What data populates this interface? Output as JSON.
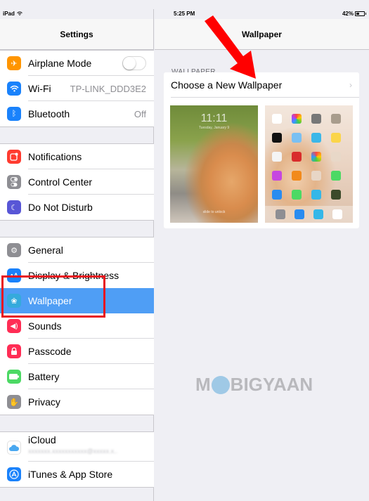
{
  "status_bar": {
    "device": "iPad",
    "time": "5:25 PM",
    "battery_percent": "42%",
    "battery_level": 0.42
  },
  "master": {
    "title": "Settings",
    "groups": [
      {
        "items": [
          {
            "label": "Airplane Mode",
            "icon": "airplane-icon",
            "color": "#ff9500",
            "toggle": false
          },
          {
            "label": "Wi-Fi",
            "icon": "wifi-icon",
            "color": "#1a82fb",
            "value": "TP-LINK_DDD3E2"
          },
          {
            "label": "Bluetooth",
            "icon": "bluetooth-icon",
            "color": "#1a82fb",
            "value": "Off"
          }
        ]
      },
      {
        "items": [
          {
            "label": "Notifications",
            "icon": "notifications-icon",
            "color": "#ff3b30"
          },
          {
            "label": "Control Center",
            "icon": "control-center-icon",
            "color": "#8e8e93"
          },
          {
            "label": "Do Not Disturb",
            "icon": "moon-icon",
            "color": "#5856d6"
          }
        ]
      },
      {
        "items": [
          {
            "label": "General",
            "icon": "gear-icon",
            "color": "#8e8e93"
          },
          {
            "label": "Display & Brightness",
            "icon": "display-brightness-icon",
            "color": "#1a82fb"
          },
          {
            "label": "Wallpaper",
            "icon": "wallpaper-icon",
            "color": "#35aadc",
            "selected": true
          },
          {
            "label": "Sounds",
            "icon": "sounds-icon",
            "color": "#ff2d55"
          },
          {
            "label": "Passcode",
            "icon": "lock-icon",
            "color": "#ff2d55"
          },
          {
            "label": "Battery",
            "icon": "battery-icon",
            "color": "#4cd964"
          },
          {
            "label": "Privacy",
            "icon": "hand-icon",
            "color": "#8e8e93"
          }
        ]
      },
      {
        "items": [
          {
            "label": "iCloud",
            "icon": "icloud-icon",
            "color": "#ffffff",
            "sublabel": "redacted account email"
          },
          {
            "label": "iTunes & App Store",
            "icon": "app-store-icon",
            "color": "#1a82fb"
          }
        ]
      }
    ]
  },
  "detail": {
    "title": "Wallpaper",
    "section_header": "WALLPAPER",
    "choose_label": "Choose a New Wallpaper",
    "lock_screen": {
      "time": "11:11",
      "date": "Tuesday, January 9",
      "slide": "slide to unlock"
    }
  },
  "watermark": {
    "left": "M",
    "right": "BIGYAAN"
  },
  "colors": {
    "selected": "#4f9ef5",
    "highlight": "#e8161c",
    "arrow": "#ff0000"
  }
}
